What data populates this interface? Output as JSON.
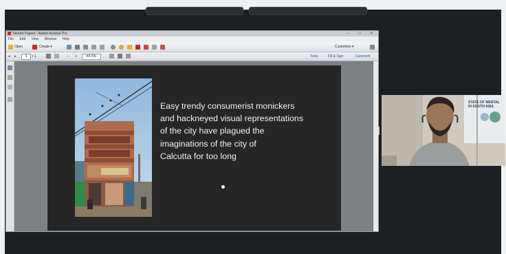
{
  "acrobat": {
    "title": "Tainted Papers - Adobe Acrobat Pro",
    "window_buttons": "– □ ×",
    "menu": [
      "File",
      "Edit",
      "View",
      "Window",
      "Help"
    ],
    "toolbar": {
      "open_label": "Open",
      "create_label": "Create ▾",
      "customize_label": "Customize ▾"
    },
    "nav": {
      "page_value": "1",
      "page_total": "/ 1",
      "zoom_value": "44.5%"
    },
    "panels": {
      "tools": "Tools",
      "fill_sign": "Fill & Sign",
      "comment": "Comment"
    }
  },
  "slide": {
    "text": "Easy trendy consumerist monickers\nand hackneyed visual representations\n of the city have plagued the\nimaginations of the city of\nCalcutta for too long"
  },
  "webcam": {
    "backdrop_text_1": "STATE OF MENTAL",
    "backdrop_text_2": "IN SOUTH ASIA"
  },
  "colors": {
    "meeting_bg": "#1b1f22",
    "slide_bg": "#262626",
    "slide_text": "#f2f2f2"
  }
}
